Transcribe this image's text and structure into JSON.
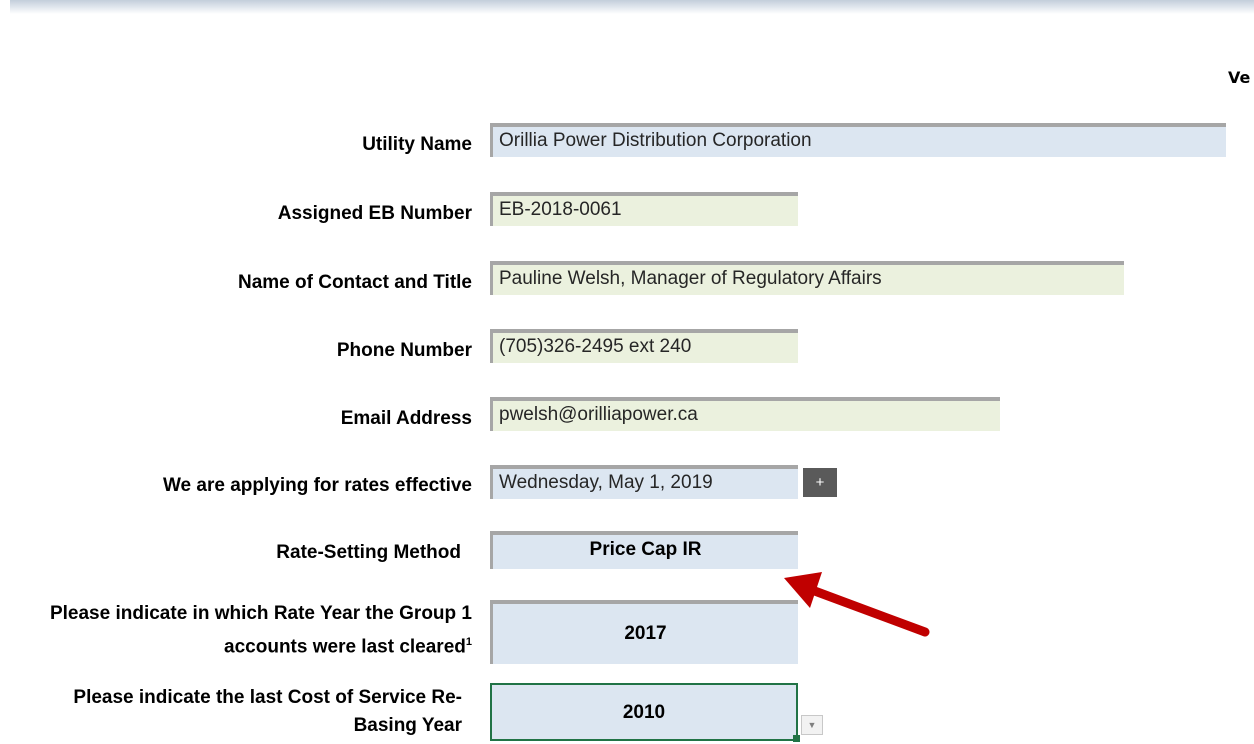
{
  "header": {
    "cut_text": "Ve"
  },
  "form": {
    "utility_name": {
      "label": "Utility Name",
      "value": "Orillia Power Distribution Corporation"
    },
    "eb_number": {
      "label": "Assigned EB Number",
      "value": "EB-2018-0061"
    },
    "contact": {
      "label": "Name of Contact and Title",
      "value": "Pauline Welsh, Manager of Regulatory Affairs"
    },
    "phone": {
      "label": "Phone Number",
      "value": "(705)326-2495 ext 240"
    },
    "email": {
      "label": "Email Address",
      "value": "pwelsh@orilliapower.ca"
    },
    "effective": {
      "label": "We are applying for rates effective",
      "value": "Wednesday, May 1, 2019",
      "button": "+"
    },
    "method": {
      "label": "Rate-Setting Method",
      "value": "Price Cap IR"
    },
    "cleared": {
      "label": "Please indicate in which Rate Year the Group 1 accounts were last cleared",
      "footnote": "1",
      "value": "2017"
    },
    "rebasing": {
      "label": "Please indicate the last Cost of Service Re-Basing Year",
      "value": "2010",
      "dropdown_icon": "chevron-down-icon"
    }
  },
  "colors": {
    "blue_field": "#dce6f1",
    "green_field": "#ebf1de",
    "selection": "#217346",
    "arrow": "#c00000"
  }
}
